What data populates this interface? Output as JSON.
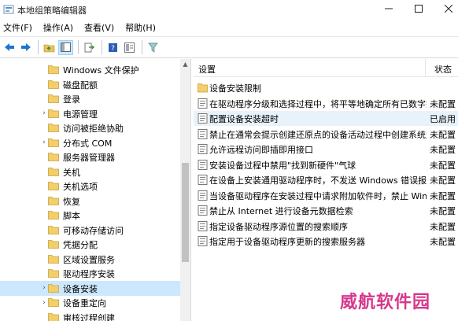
{
  "window": {
    "title": "本地组策略编辑器"
  },
  "menu": [
    "文件(F)",
    "操作(A)",
    "查看(V)",
    "帮助(H)"
  ],
  "tree": {
    "items": [
      {
        "label": "Windows 文件保护",
        "expandable": false
      },
      {
        "label": "磁盘配额",
        "expandable": false
      },
      {
        "label": "登录",
        "expandable": false
      },
      {
        "label": "电源管理",
        "expandable": true
      },
      {
        "label": "访问被拒绝协助",
        "expandable": false
      },
      {
        "label": "分布式 COM",
        "expandable": true
      },
      {
        "label": "服务器管理器",
        "expandable": false
      },
      {
        "label": "关机",
        "expandable": false
      },
      {
        "label": "关机选项",
        "expandable": false
      },
      {
        "label": "恢复",
        "expandable": false
      },
      {
        "label": "脚本",
        "expandable": false
      },
      {
        "label": "可移动存储访问",
        "expandable": false
      },
      {
        "label": "凭据分配",
        "expandable": false
      },
      {
        "label": "区域设置服务",
        "expandable": false
      },
      {
        "label": "驱动程序安装",
        "expandable": false
      },
      {
        "label": "设备安装",
        "expandable": true,
        "selected": true
      },
      {
        "label": "设备重定向",
        "expandable": true
      },
      {
        "label": "审核过程创建",
        "expandable": false
      }
    ]
  },
  "list": {
    "columns": {
      "setting": "设置",
      "status": "状态"
    },
    "rows": [
      {
        "label": "设备安装限制",
        "status": "",
        "type": "folder"
      },
      {
        "label": "在驱动程序分级和选择过程中，将平等地确定所有已数字签...",
        "status": "未配置",
        "type": "policy"
      },
      {
        "label": "配置设备安装超时",
        "status": "已启用",
        "type": "policy",
        "highlight": true
      },
      {
        "label": "禁止在通常会提示创建还原点的设备活动过程中创建系统还...",
        "status": "未配置",
        "type": "policy"
      },
      {
        "label": "允许远程访问即插即用接口",
        "status": "未配置",
        "type": "policy"
      },
      {
        "label": "安装设备过程中禁用\"找到新硬件\"气球",
        "status": "未配置",
        "type": "policy"
      },
      {
        "label": "在设备上安装通用驱动程序时，不发送 Windows 错误报告",
        "status": "未配置",
        "type": "policy"
      },
      {
        "label": "当设备驱动程序在安装过程中请求附加软件时，禁止 Wind...",
        "status": "未配置",
        "type": "policy"
      },
      {
        "label": "禁止从 Internet 进行设备元数据检索",
        "status": "未配置",
        "type": "policy"
      },
      {
        "label": "指定设备驱动程序源位置的搜索顺序",
        "status": "未配置",
        "type": "policy"
      },
      {
        "label": "指定用于设备驱动程序更新的搜索服务器",
        "status": "未配置",
        "type": "policy"
      }
    ]
  },
  "watermark": "威航软件园",
  "colors": {
    "selection": "#cce8ff",
    "folder": "#e8c25a",
    "accent": "#1e74d0",
    "watermark": "#d6388c"
  }
}
